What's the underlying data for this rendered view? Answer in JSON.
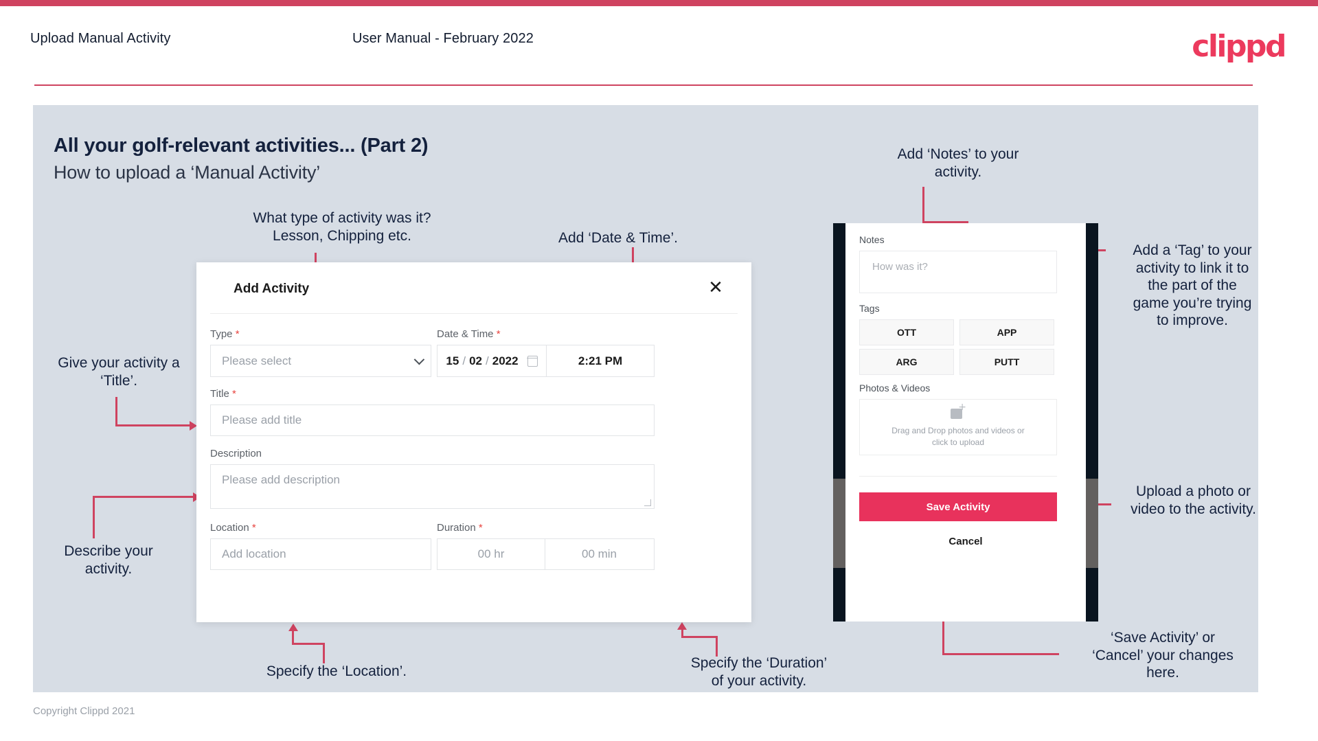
{
  "header": {
    "title": "Upload Manual Activity",
    "subtitle": "User Manual - February 2022",
    "logo": "clippd"
  },
  "slide": {
    "title": "All your golf-relevant activities... (Part 2)",
    "subtitle": "How to upload a ‘Manual Activity’",
    "footer": "Copyright Clippd 2021"
  },
  "dialog": {
    "title": "Add Activity",
    "close_icon": "close-icon",
    "fields": {
      "type": {
        "label": "Type",
        "required": "*",
        "placeholder": "Please select"
      },
      "datetime": {
        "label": "Date & Time",
        "required": "*",
        "day": "15",
        "month": "02",
        "year": "2022",
        "sep": "/",
        "time": "2:21 PM",
        "calendar_icon": "calendar-icon"
      },
      "title": {
        "label": "Title",
        "required": "*",
        "placeholder": "Please add title"
      },
      "description": {
        "label": "Description",
        "placeholder": "Please add description"
      },
      "location": {
        "label": "Location",
        "required": "*",
        "placeholder": "Add location"
      },
      "duration": {
        "label": "Duration",
        "required": "*",
        "hours": "00 hr",
        "minutes": "00 min"
      }
    }
  },
  "phone": {
    "notes": {
      "label": "Notes",
      "placeholder": "How was it?"
    },
    "tags": {
      "label": "Tags",
      "items": [
        "OTT",
        "APP",
        "ARG",
        "PUTT"
      ]
    },
    "photos": {
      "label": "Photos & Videos",
      "drop_line1": "Drag and Drop photos and videos or",
      "drop_line2": "click to upload",
      "icon": "add-image-icon"
    },
    "save_label": "Save Activity",
    "cancel_label": "Cancel"
  },
  "annotations": {
    "type": "What type of activity was it?\nLesson, Chipping etc.",
    "datetime": "Add ‘Date & Time’.",
    "title": "Give your activity a\n‘Title’.",
    "description": "Describe your\nactivity.",
    "location": "Specify the ‘Location’.",
    "duration": "Specify the ‘Duration’\nof your activity.",
    "notes": "Add ‘Notes’ to your\nactivity.",
    "tags": "Add a ‘Tag’ to your\nactivity to link it to\nthe part of the\ngame you’re trying\nto improve.",
    "upload": "Upload a photo or\nvideo to the activity.",
    "save": "‘Save Activity’ or\n‘Cancel’ your changes\nhere."
  },
  "colors": {
    "brand": "#e8325c",
    "accent_line": "#cf4360",
    "slide_bg": "#d7dde5",
    "text_dark": "#14213d"
  }
}
